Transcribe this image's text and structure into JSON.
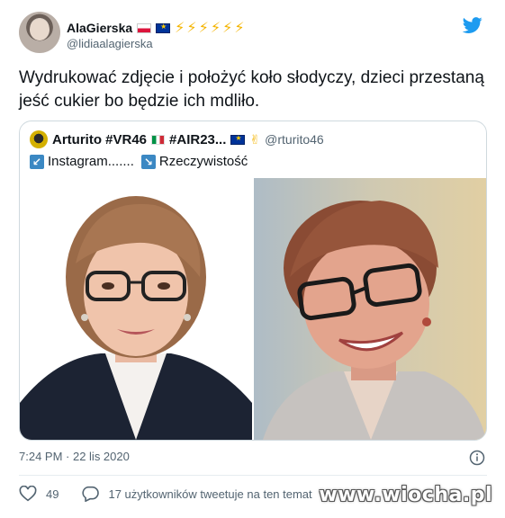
{
  "author": {
    "display_name": "AlaGierska",
    "handle": "@lidiaalagierska",
    "bolts": "⚡⚡⚡⚡⚡⚡"
  },
  "tweet": {
    "text": "Wydrukować zdjęcie i położyć koło słodyczy, dzieci przestaną jeść cukier bo będzie ich mdliło."
  },
  "quote": {
    "display_name": "Arturito #VR46",
    "name_suffix": " #AIR23...",
    "emoji": "✌",
    "handle": "@rturito46",
    "instagram_arrow": "↙",
    "instagram_label": "Instagram.......",
    "reality_arrow": "↘",
    "reality_label": "Rzeczywistość"
  },
  "footer": {
    "timestamp": "7:24 PM · 22 lis 2020",
    "likes": "49",
    "replies_text": "17 użytkowników tweetuje na ten temat"
  },
  "icons": {
    "bird": "twitter-bird-icon",
    "info": "info-icon",
    "heart": "heart-icon",
    "reply": "reply-icon"
  },
  "colors": {
    "twitter_blue": "#1d9bf0",
    "secondary_text": "#536471",
    "border": "#cfd9de"
  },
  "watermark": "www.wiocha.pl"
}
